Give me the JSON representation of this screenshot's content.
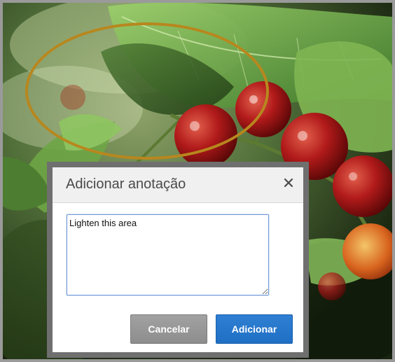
{
  "dialog": {
    "title": "Adicionar anotação",
    "close_icon": "close-icon",
    "note_value": "Lighten this area",
    "cancel_label": "Cancelar",
    "add_label": "Adicionar"
  },
  "annotation": {
    "shape": "ellipse",
    "color": "#b8871e"
  },
  "theme": {
    "primary_button": "#2a78cc",
    "secondary_button": "#999999",
    "dialog_border": "#6f6f6f"
  }
}
